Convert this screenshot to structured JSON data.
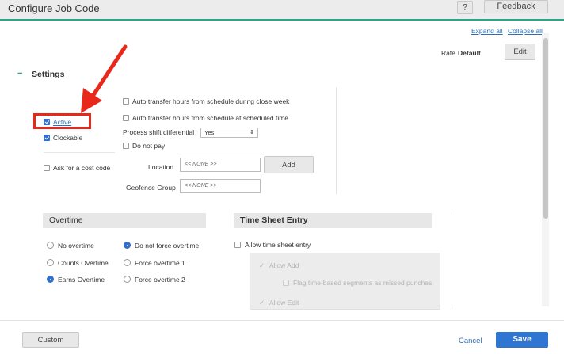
{
  "header": {
    "title": "Configure Job Code",
    "help_label": "?",
    "feedback_label": "Feedback"
  },
  "toolbar": {
    "expand_all": "Expand all",
    "collapse_all": "Collapse all",
    "rate_label": "Rate",
    "rate_value": "Default",
    "edit_label": "Edit"
  },
  "settings": {
    "toggle": "−",
    "title": "Settings",
    "active_label": "Active",
    "clockable_label": "Clockable",
    "ask_cost_code_label": "Ask for a cost code",
    "auto_transfer_close_week": "Auto transfer hours from schedule during close week",
    "auto_transfer_scheduled": "Auto transfer hours from schedule at scheduled time",
    "process_shift_label": "Process shift differential",
    "process_shift_value": "Yes",
    "do_not_pay_label": "Do not pay",
    "location_label": "Location",
    "location_value": "<< NONE >>",
    "add_label": "Add",
    "geofence_label": "Geofence Group",
    "geofence_value": "<< NONE >>"
  },
  "overtime": {
    "title": "Overtime",
    "no_overtime": "No overtime",
    "counts_overtime": "Counts Overtime",
    "earns_overtime": "Earns Overtime",
    "do_not_force": "Do not force overtime",
    "force_1": "Force overtime 1",
    "force_2": "Force overtime 2"
  },
  "timesheet": {
    "title": "Time Sheet Entry",
    "allow_entry": "Allow time sheet entry",
    "allow_add": "Allow Add",
    "flag_missed": "Flag time-based segments as missed punches",
    "allow_edit": "Allow Edit"
  },
  "footer": {
    "custom_label": "Custom",
    "cancel_label": "Cancel",
    "save_label": "Save"
  },
  "annotation": {
    "color": "#e8281b"
  }
}
